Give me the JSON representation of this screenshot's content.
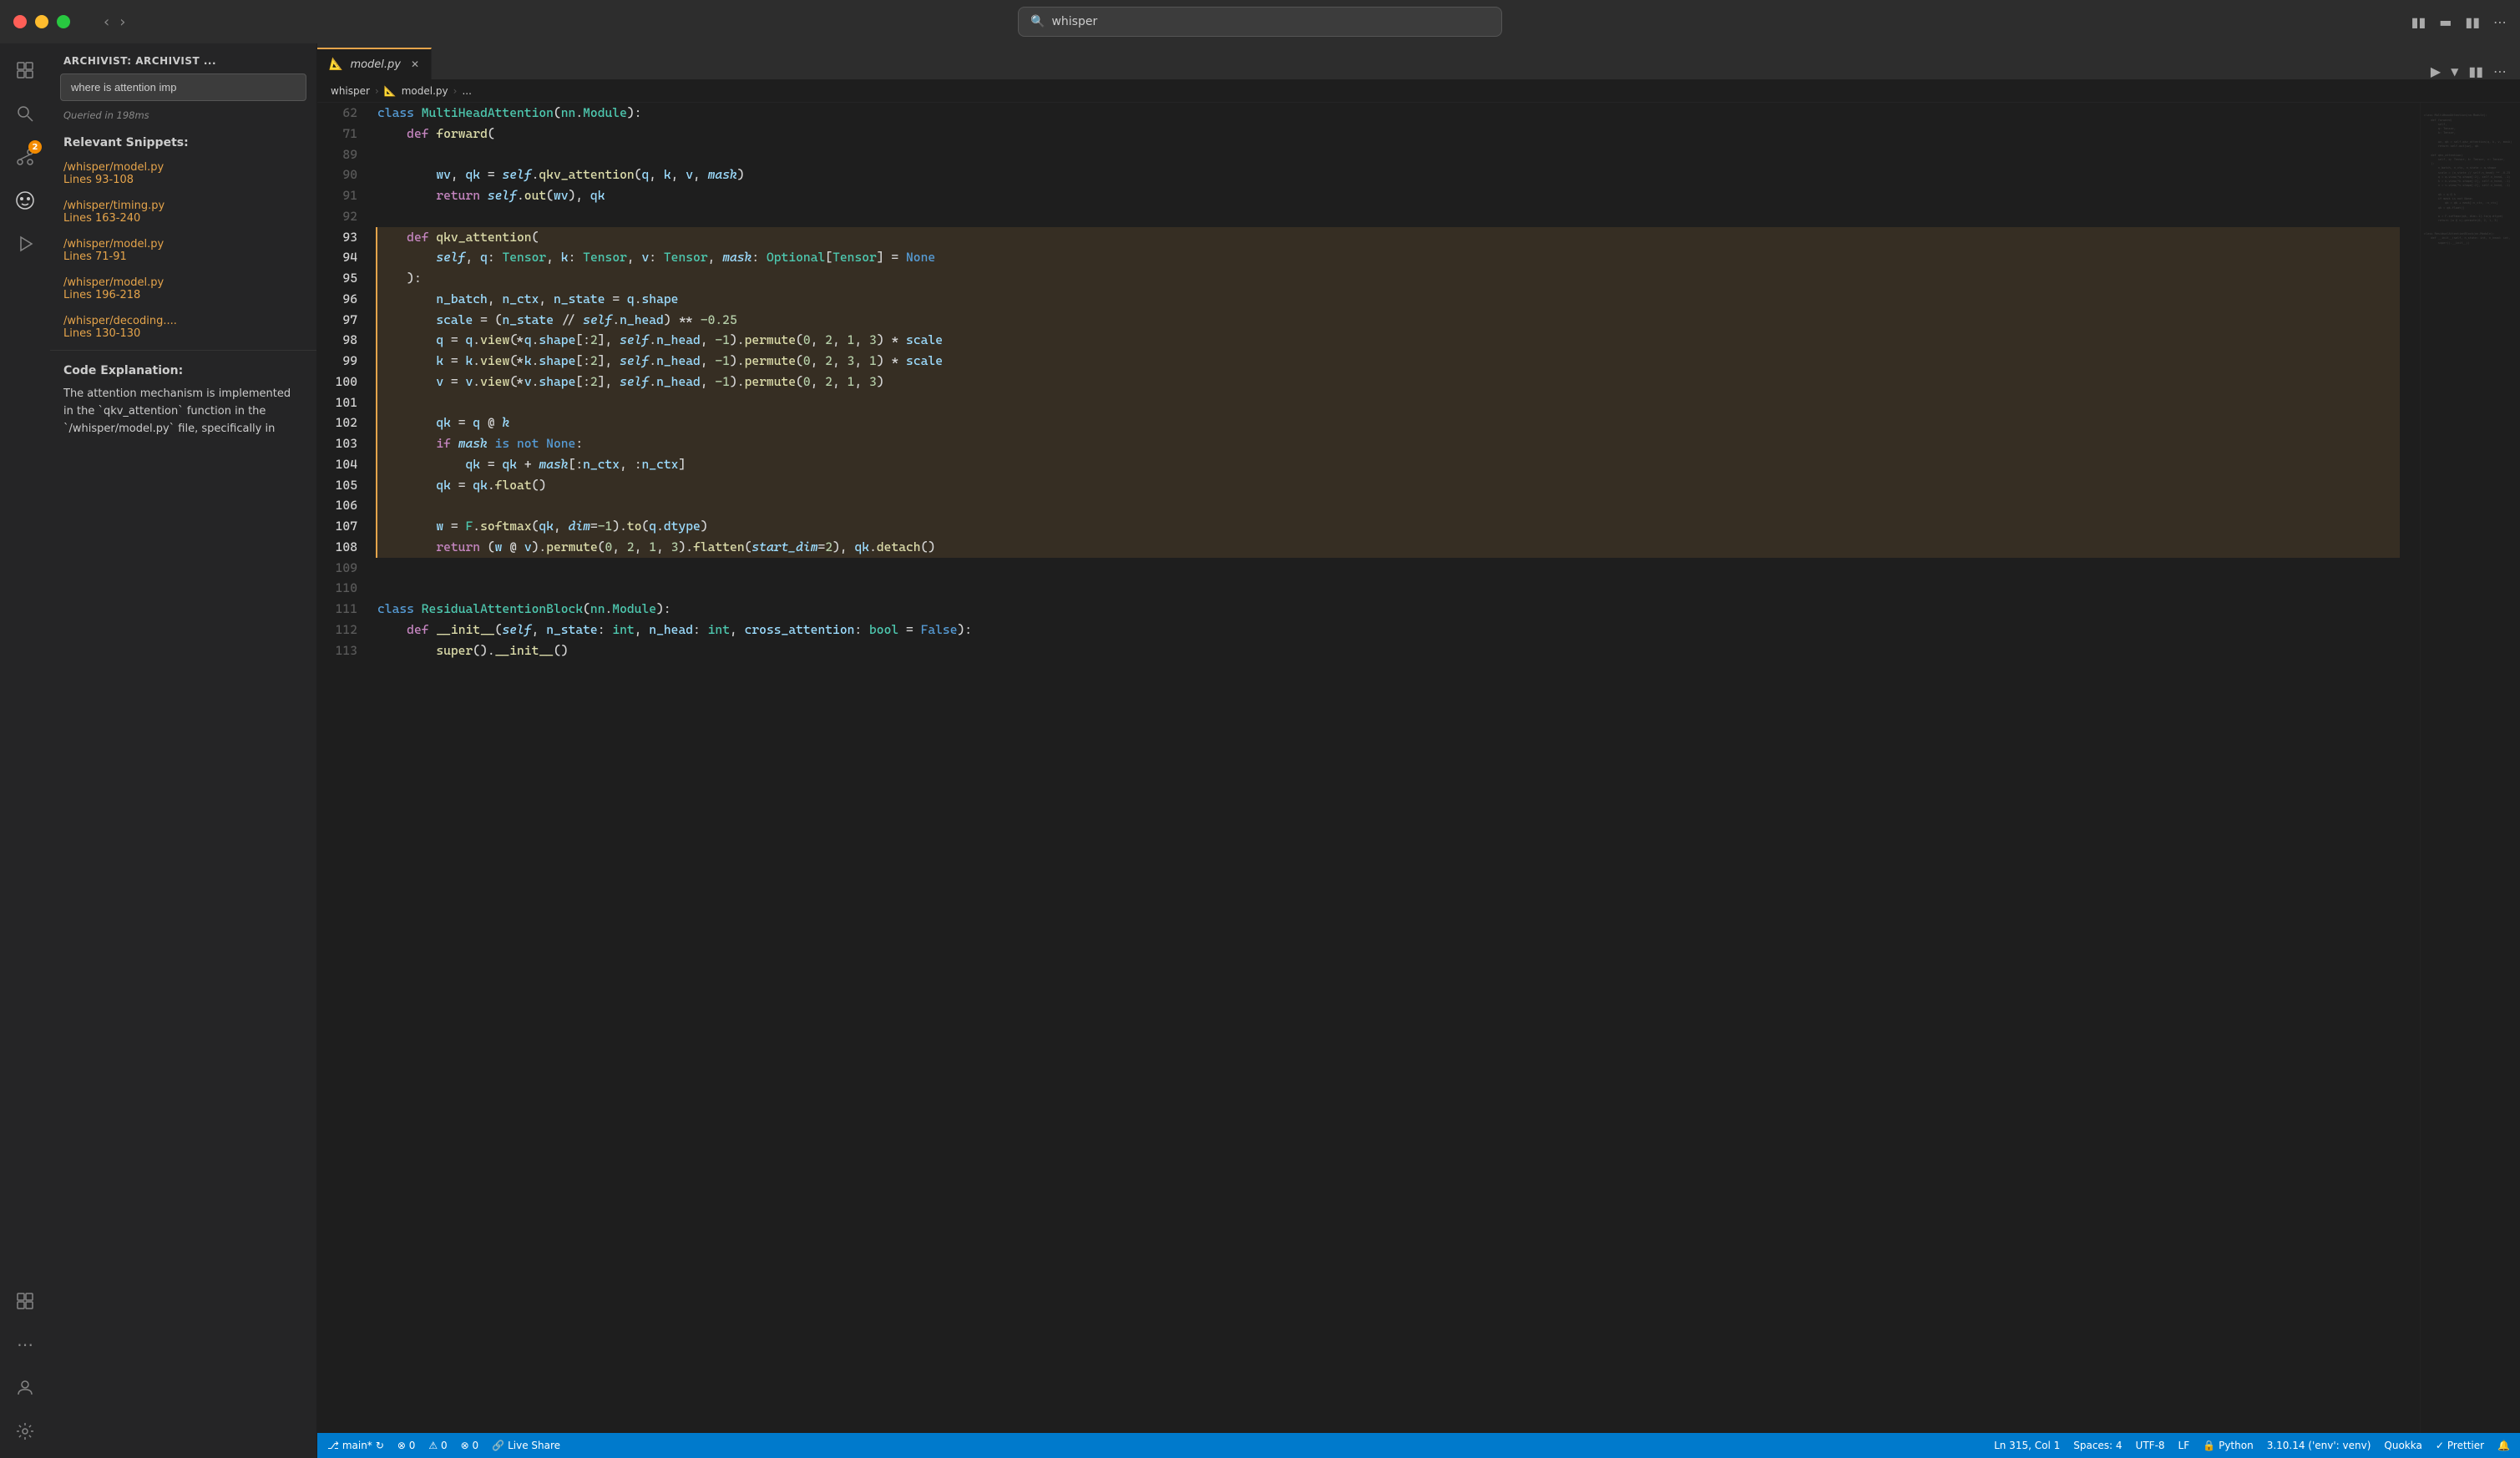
{
  "titlebar": {
    "search_placeholder": "whisper",
    "nav_back": "‹",
    "nav_forward": "›"
  },
  "window_controls": {
    "close": "close",
    "minimize": "minimize",
    "maximize": "maximize"
  },
  "activity_bar": {
    "items": [
      {
        "name": "explorer",
        "icon": "⬜",
        "active": false
      },
      {
        "name": "search",
        "icon": "🔍",
        "active": false
      },
      {
        "name": "source-control",
        "icon": "⑂",
        "active": false
      },
      {
        "name": "ai-assistant",
        "icon": "🤖",
        "active": true
      },
      {
        "name": "run-debug",
        "icon": "▷",
        "active": false
      },
      {
        "name": "extensions",
        "icon": "⊞",
        "active": false
      }
    ],
    "bottom_items": [
      {
        "name": "accounts",
        "icon": "👤"
      },
      {
        "name": "settings",
        "icon": "⚙"
      }
    ],
    "badge_count": "2"
  },
  "sidebar": {
    "header": "ARCHIVIST: ARCHIVIST ...",
    "search_value": "where is attention imp",
    "query_time": "Queried in 198ms",
    "relevant_snippets_title": "Relevant Snippets:",
    "snippets": [
      {
        "file": "/whisper/model.py",
        "lines": "Lines 93-108"
      },
      {
        "file": "/whisper/timing.py",
        "lines": "Lines 163-240"
      },
      {
        "file": "/whisper/model.py",
        "lines": "Lines 71-91"
      },
      {
        "file": "/whisper/model.py",
        "lines": "Lines 196-218"
      },
      {
        "file": "/whisper/decoding....",
        "lines": "Lines 130-130"
      }
    ],
    "code_explanation_title": "Code Explanation:",
    "code_explanation": "The attention mechanism is implemented in the `qkv_attention` function in the `/whisper/model.py` file, specifically in"
  },
  "editor": {
    "tab_name": "model.py",
    "breadcrumb": [
      "whisper",
      "model.py",
      "..."
    ],
    "toolbar_run": "▷",
    "lines": [
      {
        "num": "62",
        "text": "class MultiHeadAttention(nn.Module):"
      },
      {
        "num": "71",
        "text": "    def forward("
      },
      {
        "num": "89",
        "text": ""
      },
      {
        "num": "90",
        "text": "        wv, qk = self.qkv_attention(q, k, v, mask)"
      },
      {
        "num": "91",
        "text": "        return self.out(wv), qk"
      },
      {
        "num": "92",
        "text": ""
      },
      {
        "num": "93",
        "text": "    def qkv_attention(",
        "highlight": true
      },
      {
        "num": "94",
        "text": "        self, q: Tensor, k: Tensor, v: Tensor, mask: Optional[Tensor] = None",
        "highlight": true
      },
      {
        "num": "95",
        "text": "    ):",
        "highlight": true
      },
      {
        "num": "96",
        "text": "        n_batch, n_ctx, n_state = q.shape",
        "highlight": true
      },
      {
        "num": "97",
        "text": "        scale = (n_state // self.n_head) ** -0.25",
        "highlight": true
      },
      {
        "num": "98",
        "text": "        q = q.view(*q.shape[:2], self.n_head, -1).permute(0, 2, 1, 3) * scale",
        "highlight": true
      },
      {
        "num": "99",
        "text": "        k = k.view(*k.shape[:2], self.n_head, -1).permute(0, 2, 3, 1) * scale",
        "highlight": true
      },
      {
        "num": "100",
        "text": "        v = v.view(*v.shape[:2], self.n_head, -1).permute(0, 2, 1, 3)",
        "highlight": true
      },
      {
        "num": "101",
        "text": "",
        "highlight": true
      },
      {
        "num": "102",
        "text": "        qk = q @ k",
        "highlight": true
      },
      {
        "num": "103",
        "text": "        if mask is not None:",
        "highlight": true
      },
      {
        "num": "104",
        "text": "            qk = qk + mask[:n_ctx, :n_ctx]",
        "highlight": true
      },
      {
        "num": "105",
        "text": "        qk = qk.float()",
        "highlight": true
      },
      {
        "num": "106",
        "text": "",
        "highlight": true
      },
      {
        "num": "107",
        "text": "        w = F.softmax(qk, dim=-1).to(q.dtype)",
        "highlight": true
      },
      {
        "num": "108",
        "text": "        return (w @ v).permute(0, 2, 1, 3).flatten(start_dim=2), qk.detach()",
        "highlight": true
      },
      {
        "num": "109",
        "text": ""
      },
      {
        "num": "110",
        "text": ""
      },
      {
        "num": "111",
        "text": "class ResidualAttentionBlock(nn.Module):"
      },
      {
        "num": "112",
        "text": "    def __init__(self, n_state: int, n_head: int, cross_attention: bool = False):"
      },
      {
        "num": "113",
        "text": "        super().__init__()"
      }
    ]
  },
  "status_bar": {
    "branch": "main*",
    "sync": "↻",
    "errors": "⊗ 0",
    "warnings": "⚠ 0",
    "network": "⊗ 0",
    "live_share": "Live Share",
    "position": "Ln 315, Col 1",
    "spaces": "Spaces: 4",
    "encoding": "UTF-8",
    "line_ending": "LF",
    "language": "Python",
    "version": "3.10.14 ('env': venv)",
    "plugin1": "Quokka",
    "plugin2": "Prettier",
    "bell": "🔔"
  }
}
